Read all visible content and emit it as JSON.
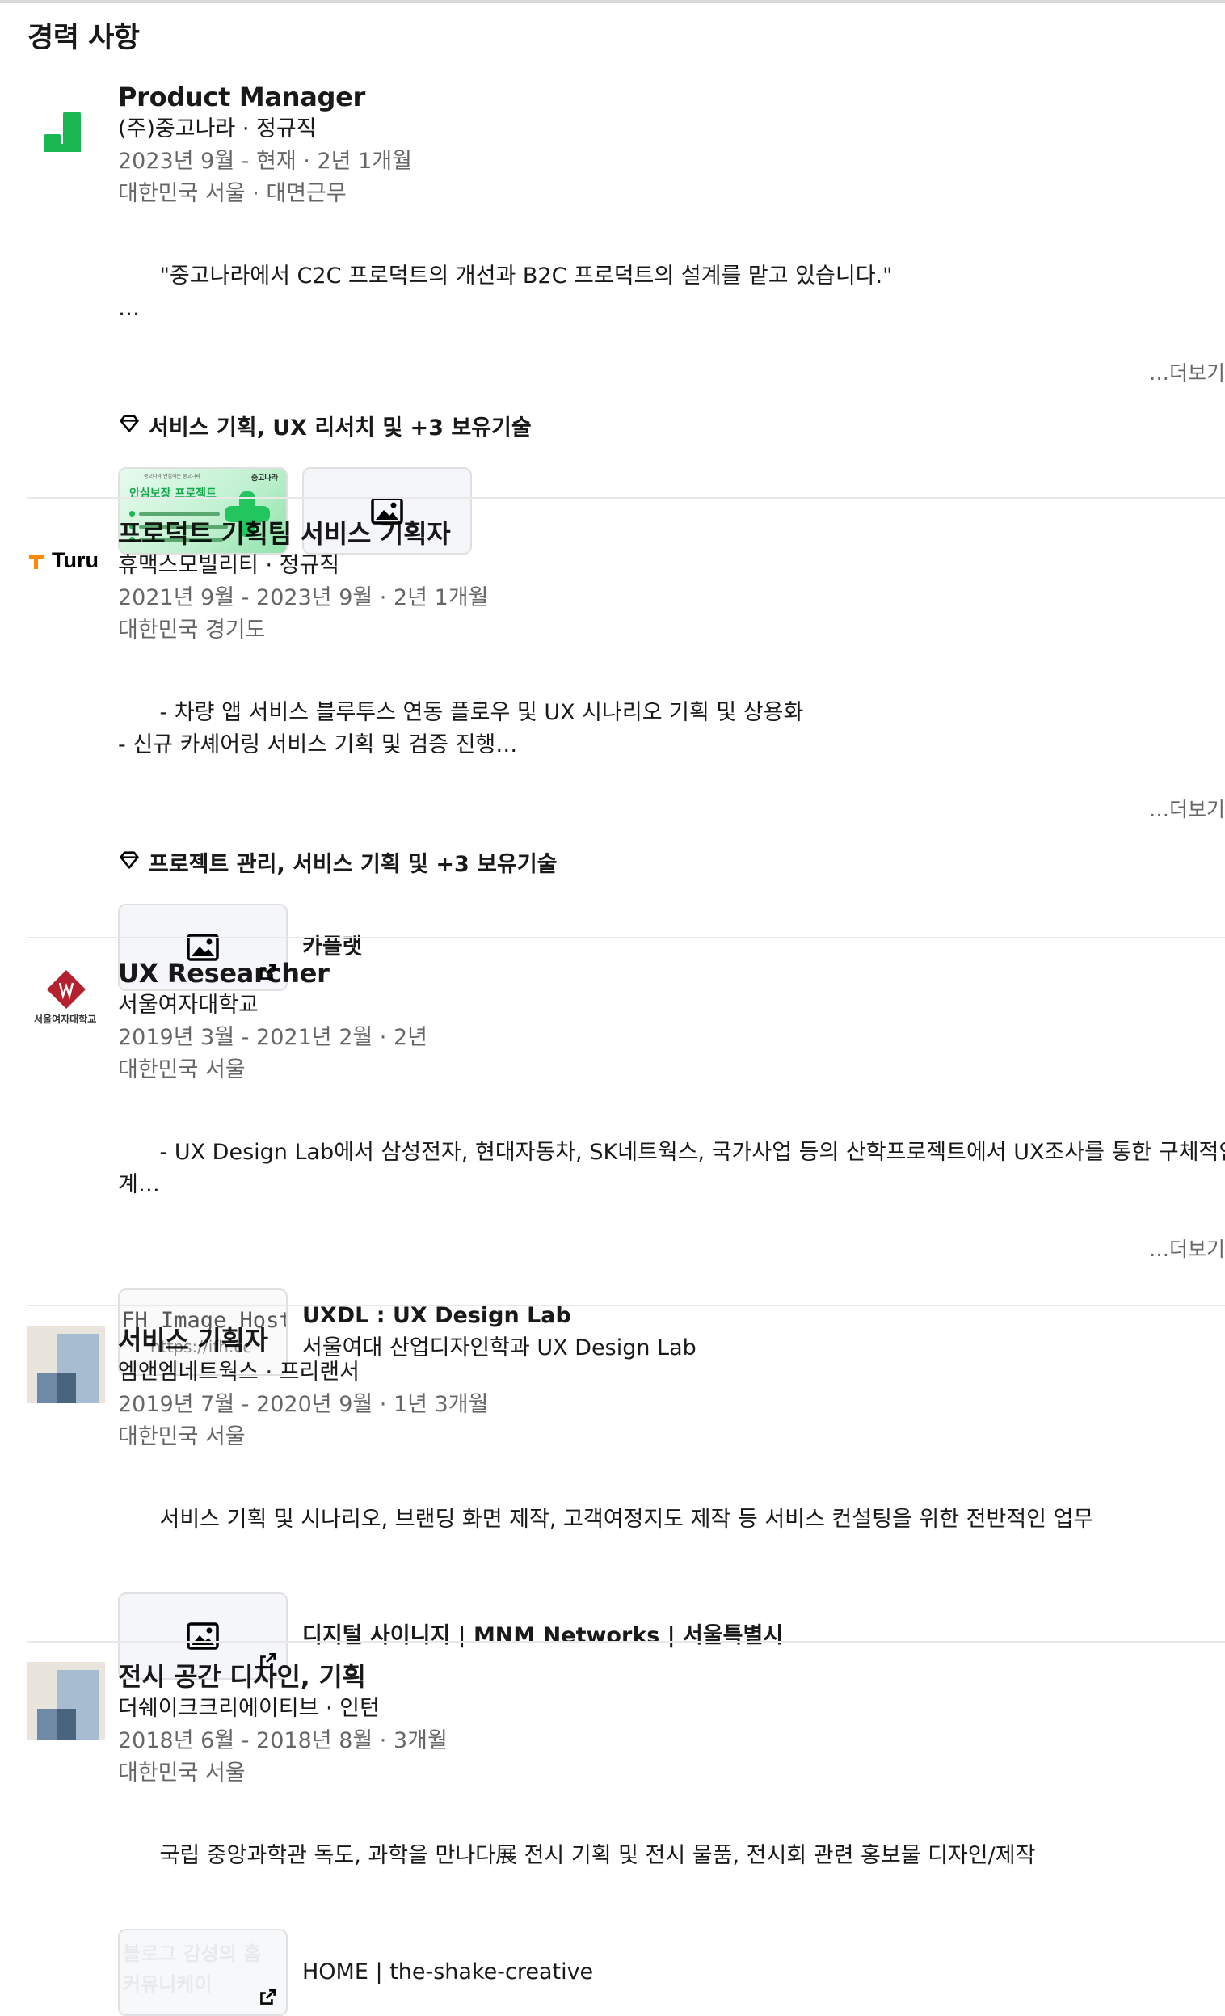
{
  "section": {
    "title": "경력 사항"
  },
  "colors": {
    "divider": "#e8e8e8",
    "accent_green": "#1ab853",
    "muted_text": "rgba(0,0,0,0.6)"
  },
  "experiences": [
    {
      "logo": "joongna-logo",
      "title": "Product Manager",
      "company": "(주)중고나라 · 정규직",
      "period": "2023년 9월 - 현재 · 2년 1개월",
      "location": "대한민국 서울 · 대면근무",
      "description": "\"중고나라에서 C2C 프로덕트의 개선과 B2C 프로덕트의 설계를 맡고 있습니다.\"\n…",
      "more": "…더보기",
      "skills": "서비스 기획, UX 리서치 및 +3 보유기술",
      "media": [
        {
          "thumb": "card",
          "card_title": "안심보장 프로젝트",
          "card_brand": "중고나라",
          "card_subtitle": "중고나라 안심하는 중고나라"
        },
        {
          "thumb": "image-icon"
        }
      ]
    },
    {
      "logo": "turu-logo",
      "logo_text": "Turu",
      "title": "프로덕트 기획팀 서비스 기획자",
      "company": "휴맥스모빌리티 · 정규직",
      "period": "2021년 9월 - 2023년 9월 · 2년 1개월",
      "location": "대한민국 경기도",
      "description": "- 차량 앱 서비스 블루투스 연동 플로우 및 UX 시나리오 기획 및 상용화\n- 신규 카셰어링 서비스 기획 및 검증 진행…",
      "more": "…더보기",
      "skills": "프로젝트 관리, 서비스 기획 및 +3 보유기술",
      "media": [
        {
          "thumb": "image-icon-external",
          "title": "카플랫"
        }
      ]
    },
    {
      "logo": "swu-logo",
      "logo_text": "서울여자대학교",
      "title": "UX Researcher",
      "company": "서울여자대학교",
      "period": "2019년 3월 - 2021년 2월 · 2년",
      "location": "대한민국 서울",
      "description": "- UX Design Lab에서 삼성전자, 현대자동차, SK네트웍스, 국가사업 등의 산학프로젝트에서 UX조사를 통한 구체적인 설\n계…",
      "more": "…더보기",
      "media": [
        {
          "thumb": "ifh",
          "thumb_text": "IFH Image Hosting",
          "thumb_url": "https://ifh.cc",
          "title": "UXDL : UX Design Lab",
          "subtitle": "서울여대 산업디자인학과 UX Design Lab"
        }
      ]
    },
    {
      "logo": "placeholder-logo",
      "title": "서비스 기획자",
      "company": "엠앤엠네트웍스 · 프리랜서",
      "period": "2019년 7월 - 2020년 9월 · 1년 3개월",
      "location": "대한민국 서울",
      "description": "서비스 기획 및 시나리오, 브랜딩 화면 제작, 고객여정지도 제작 등 서비스 컨설팅을 위한 전반적인 업무",
      "media": [
        {
          "thumb": "image-icon-external",
          "title": "디지털 사이니지 | MNM Networks | 서울특별시"
        }
      ]
    },
    {
      "logo": "placeholder-logo",
      "title": "전시 공간 디자인, 기획",
      "company": "더쉐이크크리에이티브 · 인턴",
      "period": "2018년 6월 - 2018년 8월 · 3개월",
      "location": "대한민국 서울",
      "description": "국립 중앙과학관 독도, 과학을 만나다展 전시 기획 및 전시 물품, 전시회 관련 홍보물 디자인/제작",
      "media": [
        {
          "thumb": "faded-external",
          "thumb_text": "블로그 감성의 홈 커뮤니케이",
          "title": "HOME | the-shake-creative"
        }
      ]
    }
  ]
}
